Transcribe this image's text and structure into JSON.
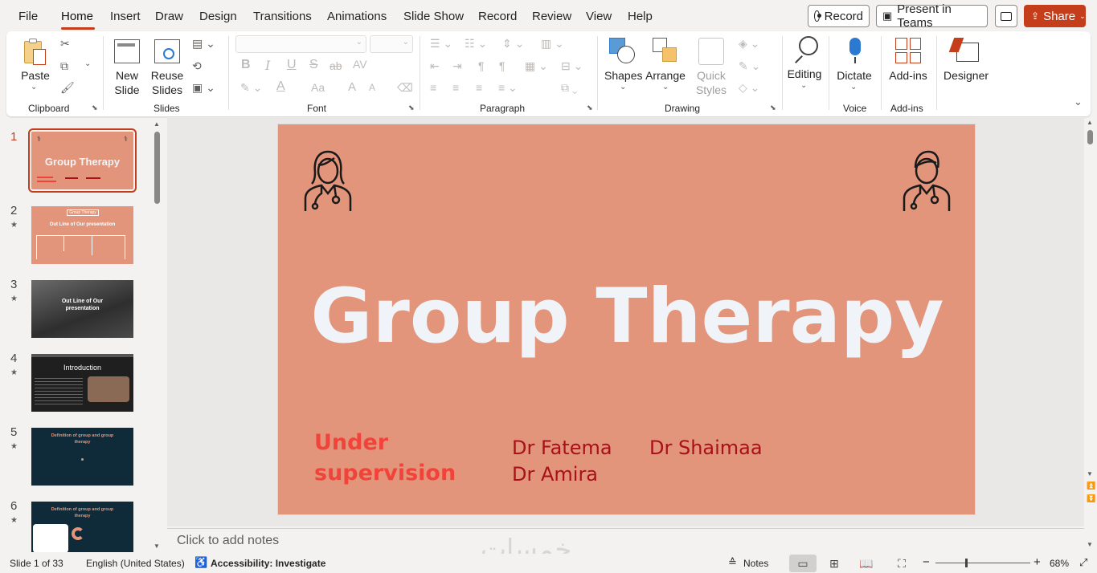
{
  "menu": {
    "items": [
      "File",
      "Home",
      "Insert",
      "Draw",
      "Design",
      "Transitions",
      "Animations",
      "Slide Show",
      "Record",
      "Review",
      "View",
      "Help"
    ],
    "record_label": "Record",
    "present_teams_label": "Present in Teams",
    "share_label": "Share"
  },
  "ribbon": {
    "paste": "Paste",
    "new_slide_1": "New",
    "new_slide_2": "Slide",
    "reuse_1": "Reuse",
    "reuse_2": "Slides",
    "shapes": "Shapes",
    "arrange": "Arrange",
    "quick_1": "Quick",
    "quick_2": "Styles",
    "editing": "Editing",
    "dictate": "Dictate",
    "addins": "Add-ins",
    "designer": "Designer",
    "groups": {
      "clipboard": "Clipboard",
      "slides": "Slides",
      "font": "Font",
      "paragraph": "Paragraph",
      "drawing": "Drawing",
      "voice": "Voice",
      "addins": "Add-ins"
    },
    "font_buttons": [
      "B",
      "I",
      "U",
      "S",
      "ab",
      "AV",
      "A",
      "Aa",
      "A",
      "A"
    ]
  },
  "thumbnails": [
    {
      "num": "1",
      "title": "Group Therapy",
      "theme": "salmon"
    },
    {
      "num": "2",
      "title": "Out Line of Our presentation",
      "header": "Group Therapy",
      "theme": "salmon"
    },
    {
      "num": "3",
      "title": "Out Line of Our presentation",
      "theme": "photo"
    },
    {
      "num": "4",
      "title": "Introduction",
      "theme": "dark"
    },
    {
      "num": "5",
      "title": "Definition of group and group therapy",
      "theme": "navy"
    },
    {
      "num": "6",
      "title": "Definition of group and group therapy",
      "theme": "navy"
    }
  ],
  "slide": {
    "title": "Group Therapy",
    "supervision_1": "Under",
    "supervision_2": "supervision",
    "doctors": [
      "Dr Fatema",
      "Dr Amira",
      "Dr Shaimaa"
    ],
    "background": "#e2957a"
  },
  "notes_placeholder": "Click to add notes",
  "status": {
    "slide_info": "Slide 1 of 33",
    "language": "English (United States)",
    "accessibility": "Accessibility: Investigate",
    "notes": "Notes",
    "zoom": "68%"
  },
  "watermark": "خمسات",
  "colors": {
    "accent": "#c43e1c",
    "slide_bg": "#e2957a",
    "title": "#f0f4f8",
    "supervision": "#f2433b",
    "doctors": "#a8101a"
  }
}
